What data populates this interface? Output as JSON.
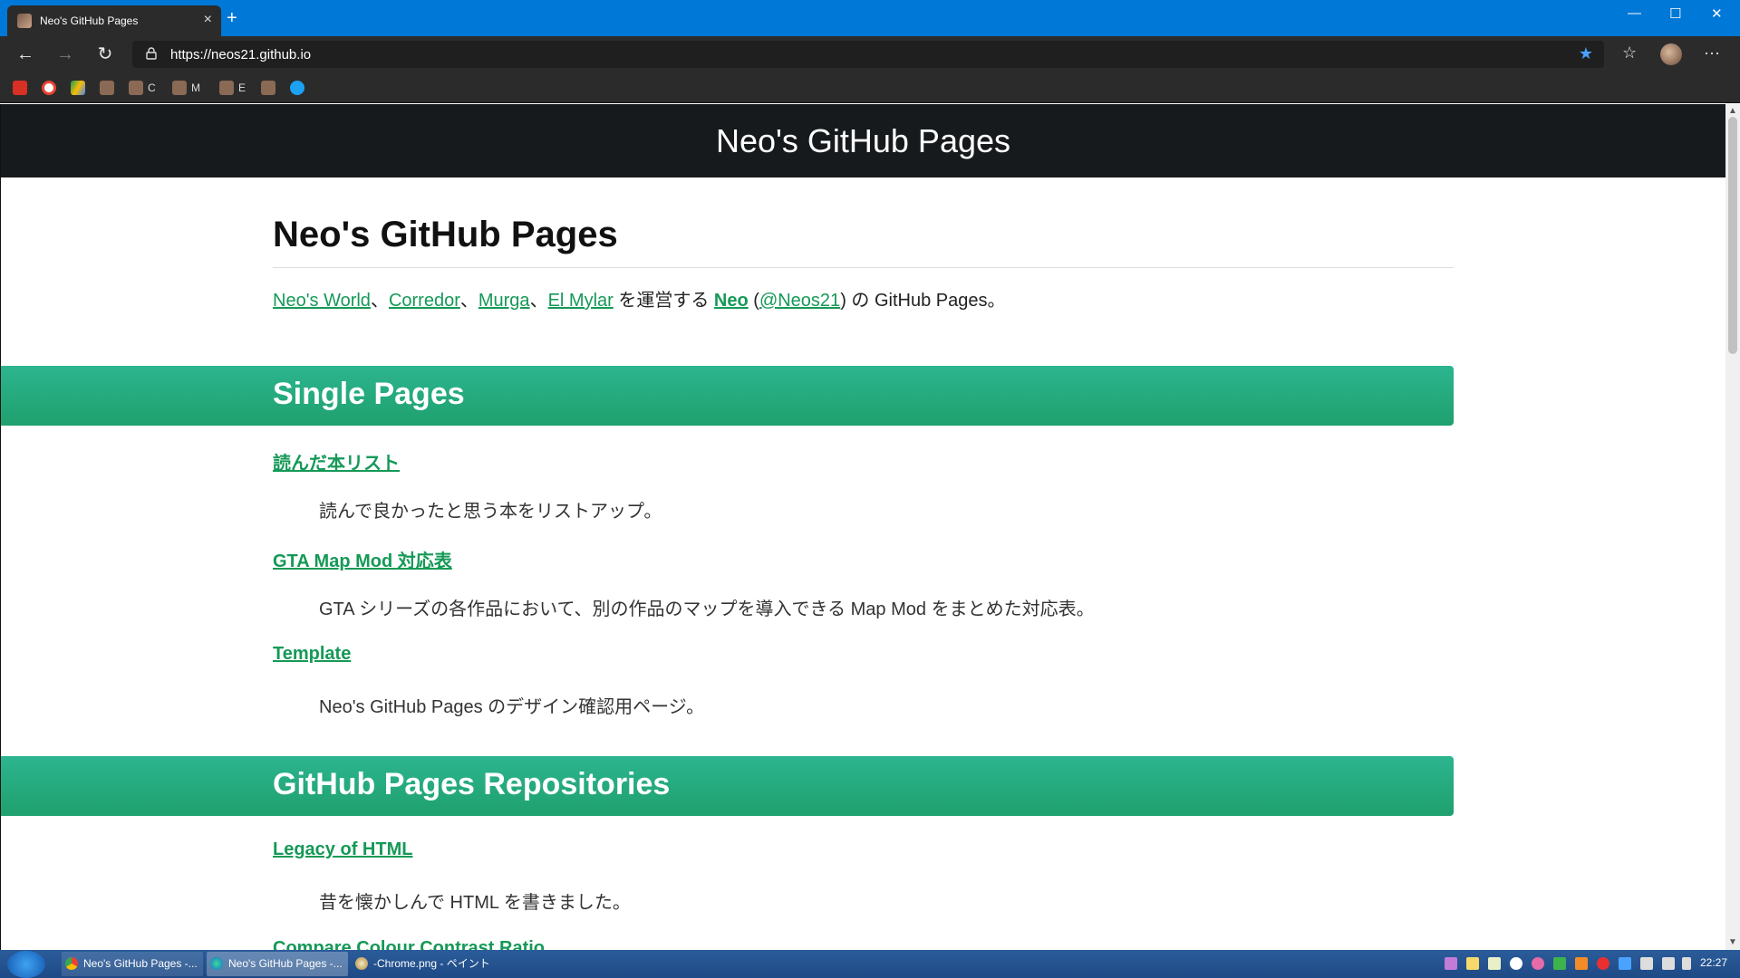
{
  "browser": {
    "tab_title": "Neo's GitHub Pages",
    "tab_close": "×",
    "new_tab": "+",
    "url": "https://neos21.github.io",
    "window_controls": {
      "minimize": "—",
      "maximize": "☐",
      "close": "✕"
    },
    "nav": {
      "back": "←",
      "forward": "→",
      "refresh": "↻"
    },
    "star": "★",
    "favorites": "☆",
    "menu": "···",
    "bookmarks": [
      {
        "icon": "gmail-icon",
        "label": ""
      },
      {
        "icon": "google-icon",
        "label": ""
      },
      {
        "icon": "drive-icon",
        "label": ""
      },
      {
        "icon": "avatar-icon",
        "label": ""
      },
      {
        "icon": "avatar-icon",
        "label": "C"
      },
      {
        "icon": "avatar-icon",
        "label": "M"
      },
      {
        "icon": "avatar-icon",
        "label": "E"
      },
      {
        "icon": "avatar-icon",
        "label": ""
      },
      {
        "icon": "twitter-icon",
        "label": ""
      }
    ]
  },
  "site": {
    "header_title": "Neo's GitHub Pages",
    "page_title": "Neo's GitHub Pages",
    "intro": {
      "link1": "Neo's World",
      "sep1": "、",
      "link2": "Corredor",
      "sep2": "、",
      "link3": "Murga",
      "sep3": "、",
      "link4": "El Mylar",
      "text1": " を運営する ",
      "link_neo": "Neo",
      "paren_open": " (",
      "link_twitter": "@Neos21",
      "paren_close": ")",
      "text2": " の GitHub Pages。"
    },
    "sections": [
      {
        "title": "Single Pages",
        "entries": [
          {
            "link": "読んだ本リスト",
            "desc": "読んで良かったと思う本をリストアップ。"
          },
          {
            "link": "GTA Map Mod 対応表",
            "desc": "GTA シリーズの各作品において、別の作品のマップを導入できる Map Mod をまとめた対応表。"
          },
          {
            "link": "Template",
            "desc": "Neo's GitHub Pages のデザイン確認用ページ。"
          }
        ]
      },
      {
        "title": "GitHub Pages Repositories",
        "entries": [
          {
            "link": "Legacy of HTML",
            "desc": "昔を懐かしんで HTML を書きました。"
          },
          {
            "link": "Compare Colour Contrast Ratio",
            "desc": ""
          }
        ]
      }
    ]
  },
  "taskbar": {
    "tasks": [
      {
        "label": "Neo's GitHub Pages -..."
      },
      {
        "label": "Neo's GitHub Pages -..."
      },
      {
        "label": "-Chrome.png - ペイント"
      }
    ],
    "clock": "22:27"
  },
  "colors": {
    "titlebar": "#0078d7",
    "accent_green": "#159957",
    "section_band": "#1fa06e",
    "header_bg": "#161a1d"
  }
}
